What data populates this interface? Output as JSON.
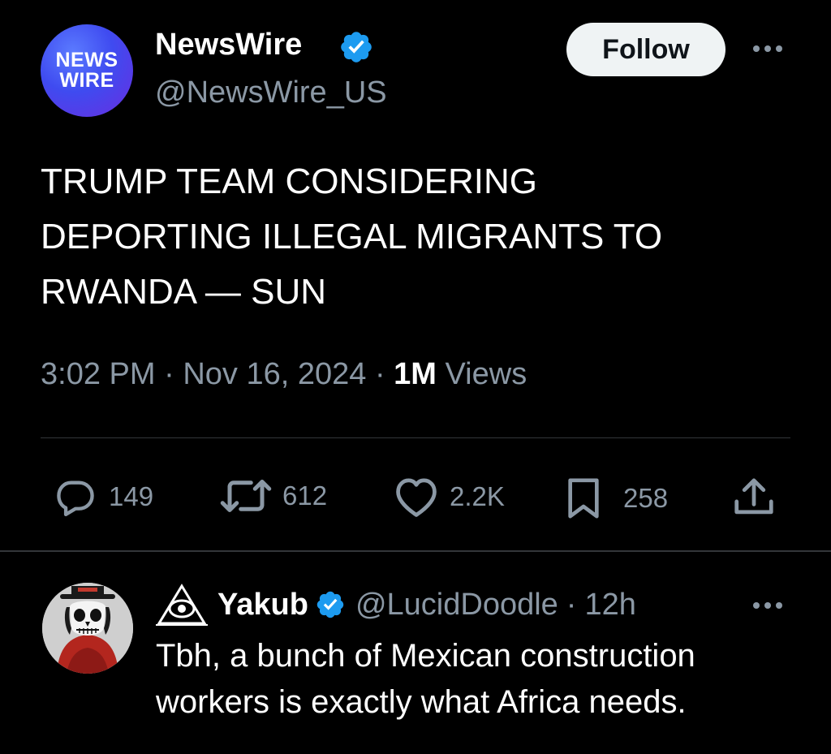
{
  "post": {
    "avatar": {
      "line1": "NEWS",
      "line2": "WIRE"
    },
    "display_name": "NewsWire",
    "handle": "@NewsWire_US",
    "follow_label": "Follow",
    "text": "TRUMP TEAM CONSIDERING\nDEPORTING ILLEGAL MIGRANTS TO\nRWANDA — SUN",
    "time": "3:02 PM",
    "date": "Nov 16, 2024",
    "views_count": "1M",
    "views_label": "Views",
    "sep": "·",
    "actions": {
      "replies": "149",
      "reposts": "612",
      "likes": "2.2K",
      "bookmarks": "258"
    }
  },
  "reply": {
    "display_name": "Yakub",
    "handle": "@LucidDoodle",
    "age": "12h",
    "text": "Tbh, a bunch of Mexican construction workers is exactly what Africa needs."
  },
  "colors": {
    "background": "#000000",
    "verified": "#1d9bf0",
    "muted_text": "#8b98a5"
  },
  "icons": [
    "verified-badge-icon",
    "more-icon",
    "reply-icon",
    "repost-icon",
    "like-icon",
    "bookmark-icon",
    "share-icon",
    "illuminati-eye-icon"
  ]
}
